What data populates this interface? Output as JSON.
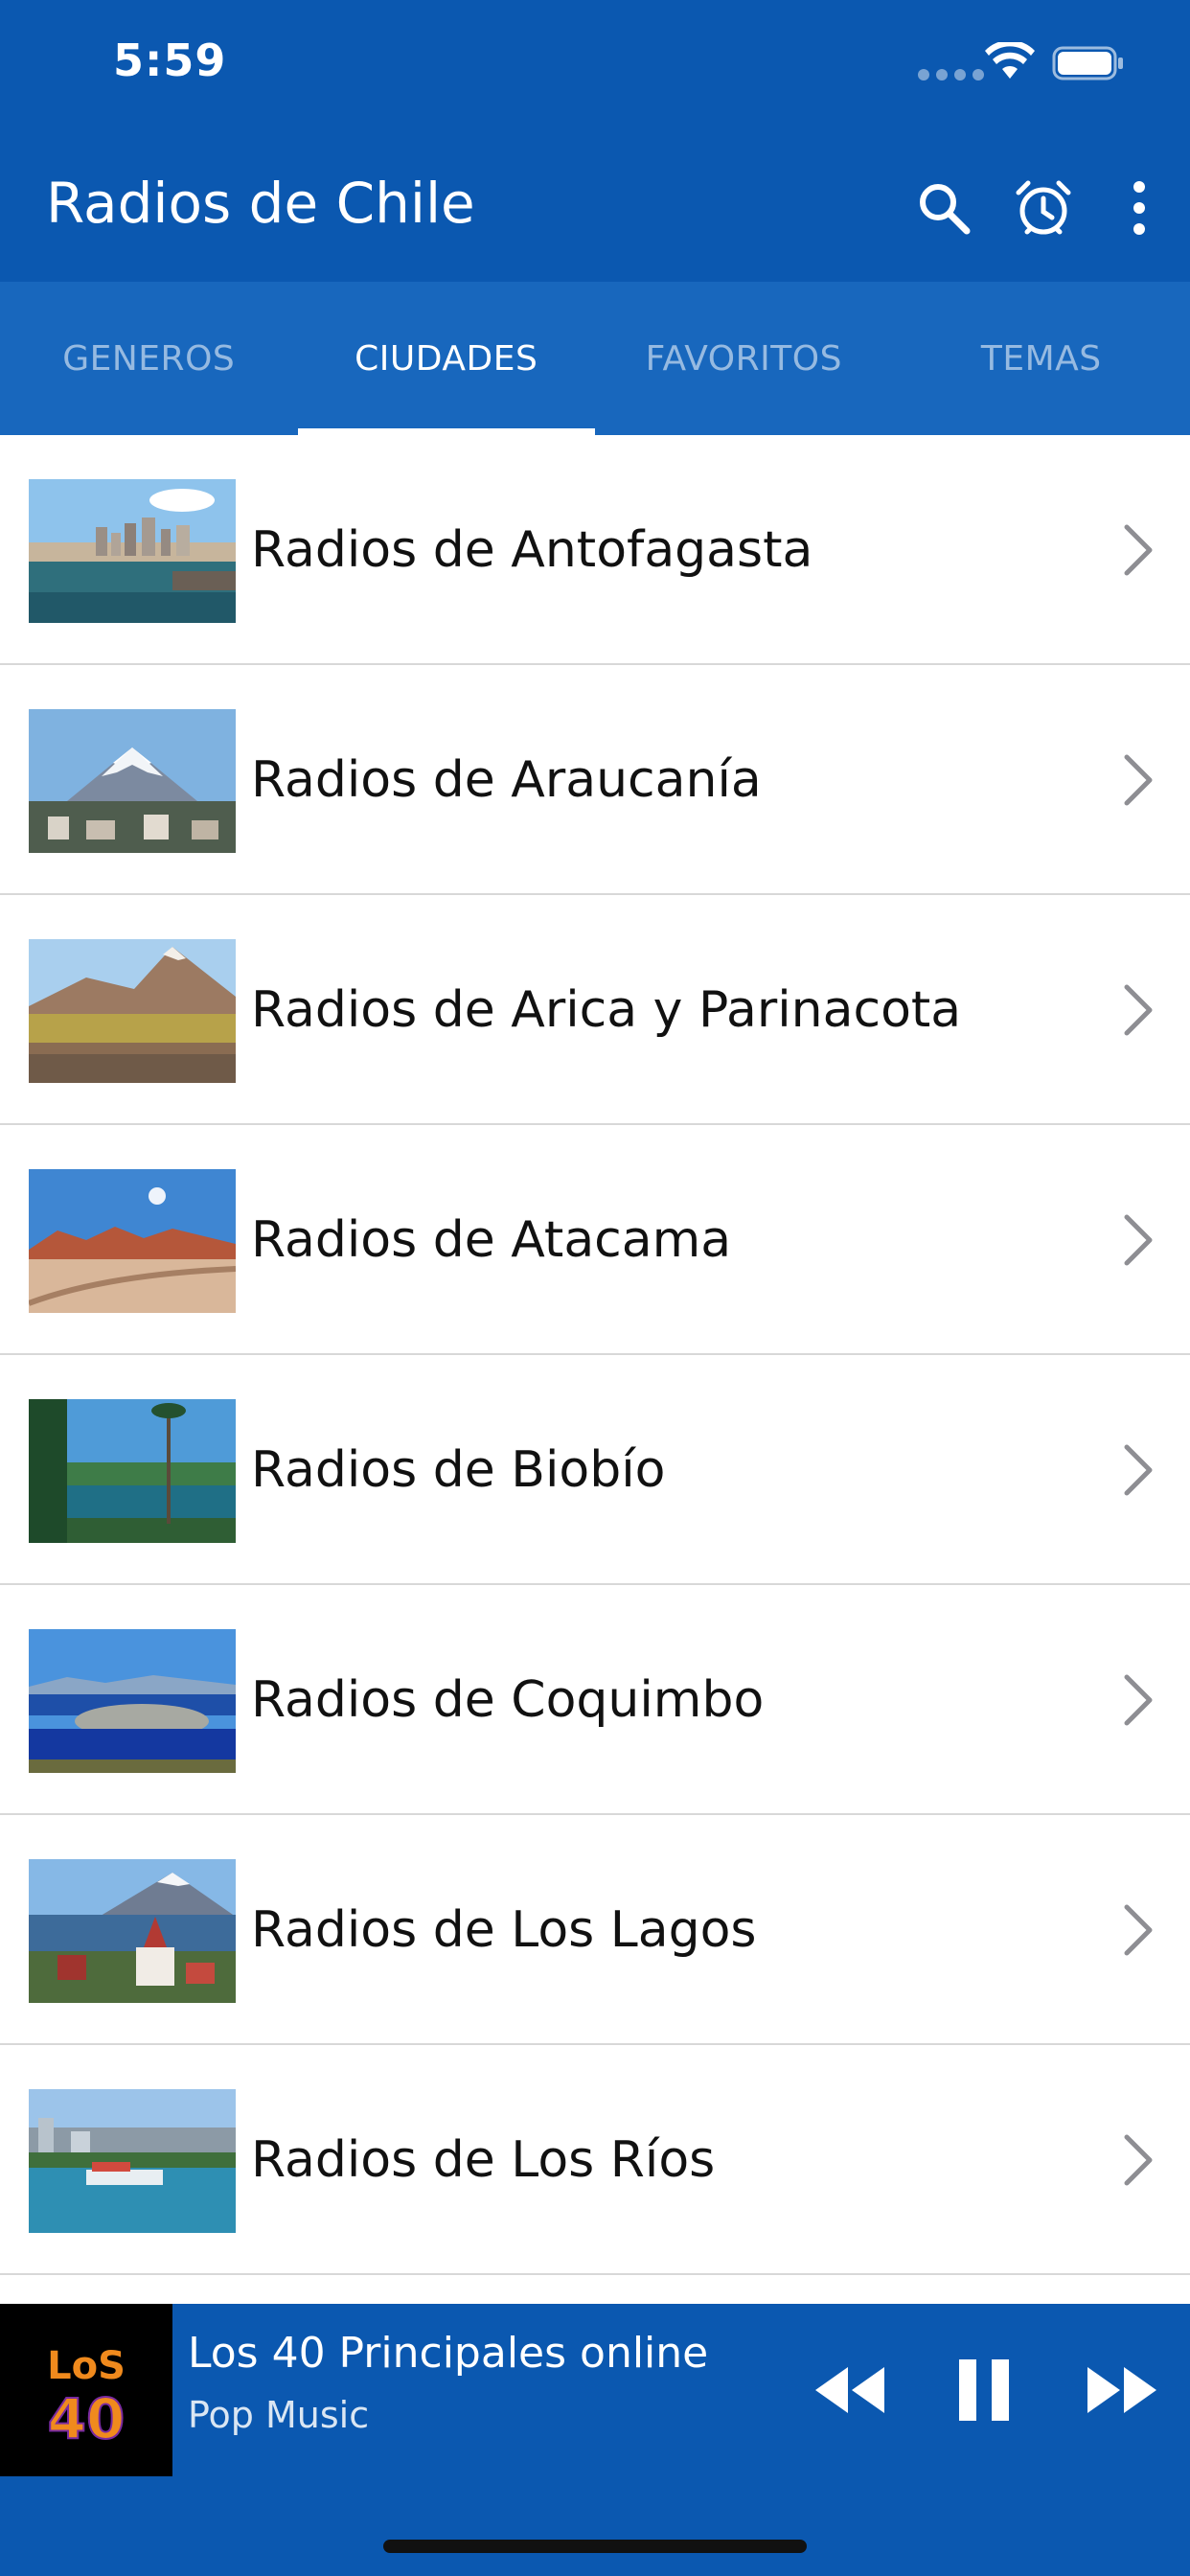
{
  "status_bar": {
    "time": "5:59"
  },
  "app_bar": {
    "title": "Radios de Chile",
    "icons": [
      "search-icon",
      "alarm-icon",
      "more-vertical-icon"
    ]
  },
  "tabs": [
    {
      "label": "GENEROS",
      "active": false
    },
    {
      "label": "CIUDADES",
      "active": true
    },
    {
      "label": "FAVORITOS",
      "active": false
    },
    {
      "label": "TEMAS",
      "active": false
    }
  ],
  "cities": [
    {
      "label": "Radios de Antofagasta",
      "thumb": "coastal-city-photo"
    },
    {
      "label": "Radios de Araucanía",
      "thumb": "snow-volcano-photo"
    },
    {
      "label": "Radios de Arica y Parinacota",
      "thumb": "altiplano-lagoon-photo"
    },
    {
      "label": "Radios de Atacama",
      "thumb": "desert-moon-photo"
    },
    {
      "label": "Radios de Biobío",
      "thumb": "araucaria-lake-photo"
    },
    {
      "label": "Radios de Coquimbo",
      "thumb": "bay-town-photo"
    },
    {
      "label": "Radios de Los Lagos",
      "thumb": "lake-church-volcano-photo"
    },
    {
      "label": "Radios de Los Ríos",
      "thumb": "river-port-photo"
    }
  ],
  "player": {
    "title": "Los 40 Principales online",
    "subtitle": "Pop Music",
    "logo_text": "LOS 40"
  },
  "colors": {
    "primary": "#0b58b0",
    "tab_bar": "#1867bd",
    "text": "#111111",
    "divider": "#d8d8d8"
  }
}
